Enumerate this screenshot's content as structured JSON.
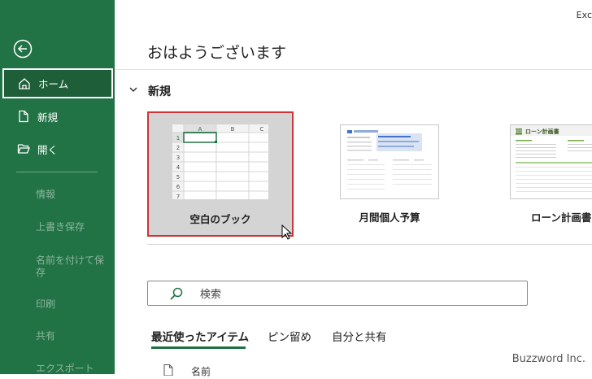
{
  "app": {
    "name": "Exc"
  },
  "sidebar": {
    "items": [
      {
        "label": "ホーム",
        "icon": "home-icon"
      },
      {
        "label": "新規",
        "icon": "new-document-icon"
      },
      {
        "label": "開く",
        "icon": "folder-open-icon"
      }
    ],
    "disabled_items": [
      "情報",
      "上書き保存",
      "名前を付けて保存",
      "印刷",
      "共有",
      "エクスポート"
    ]
  },
  "main": {
    "greeting": "おはようございます",
    "new_section": {
      "title": "新規",
      "templates": [
        {
          "name": "空白のブック"
        },
        {
          "name": "月間個人予算"
        },
        {
          "name": "ローン計画書"
        }
      ],
      "blank_thumb": {
        "columns": [
          "A",
          "B",
          "C"
        ],
        "rows": [
          "1",
          "2",
          "3",
          "4",
          "5",
          "6",
          "7"
        ]
      },
      "loan_thumb_title": "ローン計画書"
    },
    "search": {
      "placeholder": "検索"
    },
    "tabs": [
      {
        "label": "最近使ったアイテム"
      },
      {
        "label": "ピン留め"
      },
      {
        "label": "自分と共有"
      }
    ],
    "list_header": {
      "name": "名前"
    }
  },
  "watermark": "Buzzword Inc.",
  "colors": {
    "sidebar": "#217346",
    "selection_border": "#d13438",
    "accent": "#217346"
  }
}
